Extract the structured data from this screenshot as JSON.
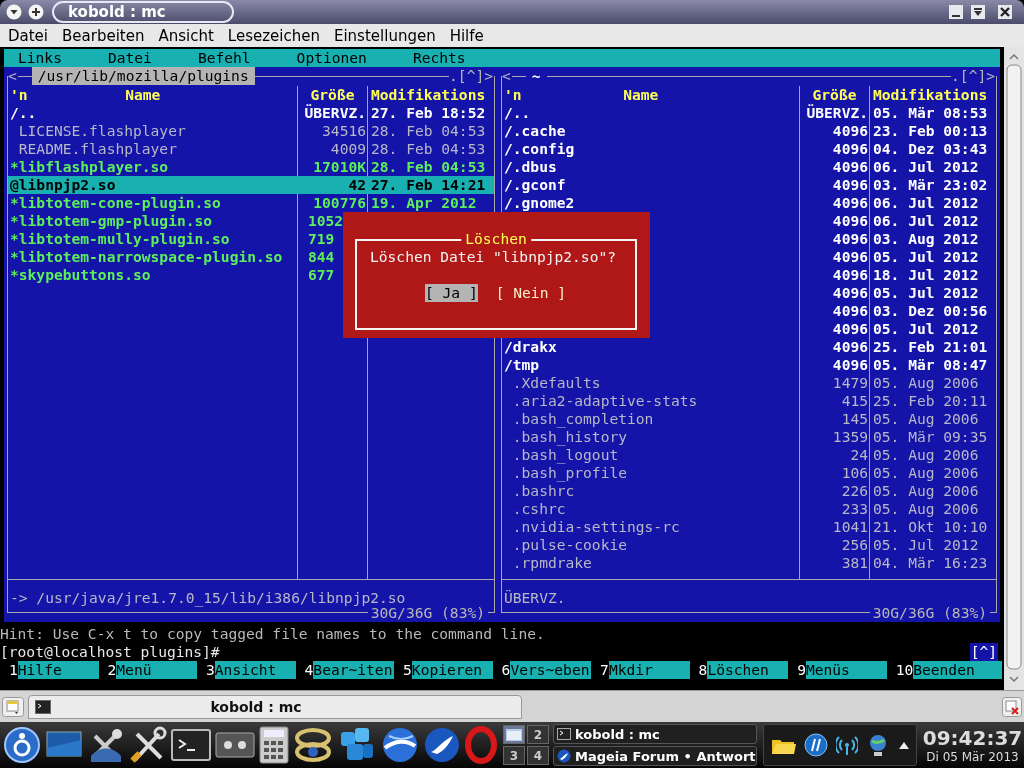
{
  "window": {
    "title": "kobold : mc"
  },
  "menu": [
    "Datei",
    "Bearbeiten",
    "Ansicht",
    "Lesezeichen",
    "Einstellungen",
    "Hilfe"
  ],
  "mc_menu": [
    "Links",
    "Datei",
    "Befehl",
    "Optionen",
    "Rechts"
  ],
  "panels": [
    {
      "active": true,
      "left_marker": "<",
      "path": "/usr/lib/mozilla/plugins",
      "right_marker": ".[^]>",
      "columns": [
        "'n",
        "Name",
        "Größe",
        "Modifikations"
      ],
      "rows": [
        {
          "kind": "dir",
          "name": "/..",
          "size": "ÜBERVZ.",
          "date": "27. Feb 18:52",
          "selected": false
        },
        {
          "kind": "file",
          "name": " LICENSE.flashplayer",
          "size": "34516",
          "date": "28. Feb 04:53",
          "selected": false
        },
        {
          "kind": "file",
          "name": " README.flashplayer",
          "size": "4009",
          "date": "28. Feb 04:53",
          "selected": false
        },
        {
          "kind": "exec",
          "name": "*libflashplayer.so",
          "size": "17010K",
          "date": "28. Feb 04:53",
          "selected": false
        },
        {
          "kind": "link",
          "name": "@libnpjp2.so",
          "size": "42",
          "date": "27. Feb 14:21",
          "selected": true
        },
        {
          "kind": "exec",
          "name": "*libtotem-cone-plugin.so",
          "size": "100776",
          "date": "19. Apr 2012",
          "selected": false
        },
        {
          "kind": "exec",
          "name": "*libtotem-gmp-plugin.so",
          "size": "1052",
          "clipped": true,
          "selected": false
        },
        {
          "kind": "exec",
          "name": "*libtotem-mully-plugin.so",
          "size": "719",
          "clipped": true,
          "selected": false
        },
        {
          "kind": "exec",
          "name": "*libtotem-narrowspace-plugin.so",
          "size": "844",
          "clipped": true,
          "selected": false
        },
        {
          "kind": "exec",
          "name": "*skypebuttons.so",
          "size": "677",
          "clipped": true,
          "selected": false
        }
      ],
      "status": "-> /usr/java/jre1.7.0_15/lib/i386/libnpjp2.so",
      "disk": "30G/36G (83%)"
    },
    {
      "active": false,
      "left_marker": "<",
      "path": "~",
      "right_marker": ".[^]>",
      "columns": [
        "'n",
        "Name",
        "Größe",
        "Modifikations"
      ],
      "rows": [
        {
          "kind": "dir",
          "name": "/..",
          "size": "ÜBERVZ.",
          "date": "05. Mär 08:53",
          "selected": false
        },
        {
          "kind": "dir",
          "name": "/.cache",
          "size": "4096",
          "date": "23. Feb 00:13",
          "selected": false
        },
        {
          "kind": "dir",
          "name": "/.config",
          "size": "4096",
          "date": "04. Dez 03:43",
          "selected": false
        },
        {
          "kind": "dir",
          "name": "/.dbus",
          "size": "4096",
          "date": "06. Jul 2012",
          "selected": false
        },
        {
          "kind": "dir",
          "name": "/.gconf",
          "size": "4096",
          "date": "03. Mär 23:02",
          "selected": false
        },
        {
          "kind": "dir",
          "name": "/.gnome2",
          "size": "4096",
          "date": "06. Jul 2012",
          "selected": false
        },
        {
          "kind": "dir",
          "size": "4096",
          "date": "06. Jul 2012",
          "selected": false
        },
        {
          "kind": "dir",
          "size": "4096",
          "date": "03. Aug 2012",
          "selected": false
        },
        {
          "kind": "dir",
          "size": "4096",
          "date": "05. Jul 2012",
          "selected": false
        },
        {
          "kind": "dir",
          "size": "4096",
          "date": "18. Jul 2012",
          "selected": false
        },
        {
          "kind": "dir",
          "size": "4096",
          "date": "05. Jul 2012",
          "selected": false
        },
        {
          "kind": "dir",
          "size": "4096",
          "date": "03. Dez 00:56",
          "selected": false
        },
        {
          "kind": "dir",
          "size": "4096",
          "date": "05. Jul 2012",
          "selected": false
        },
        {
          "kind": "dir",
          "name": "/drakx",
          "size": "4096",
          "date": "25. Feb 21:01",
          "selected": false
        },
        {
          "kind": "dir",
          "name": "/tmp",
          "size": "4096",
          "date": "05. Mär 08:47",
          "selected": false
        },
        {
          "kind": "file",
          "name": " .Xdefaults",
          "size": "1479",
          "date": "05. Aug 2006",
          "selected": false
        },
        {
          "kind": "file",
          "name": " .aria2-adaptive-stats",
          "size": "415",
          "date": "25. Feb 20:11",
          "selected": false
        },
        {
          "kind": "file",
          "name": " .bash_completion",
          "size": "145",
          "date": "05. Aug 2006",
          "selected": false
        },
        {
          "kind": "file",
          "name": " .bash_history",
          "size": "1359",
          "date": "05. Mär 09:35",
          "selected": false
        },
        {
          "kind": "file",
          "name": " .bash_logout",
          "size": "24",
          "date": "05. Aug 2006",
          "selected": false
        },
        {
          "kind": "file",
          "name": " .bash_profile",
          "size": "106",
          "date": "05. Aug 2006",
          "selected": false
        },
        {
          "kind": "file",
          "name": " .bashrc",
          "size": "226",
          "date": "05. Aug 2006",
          "selected": false
        },
        {
          "kind": "file",
          "name": " .cshrc",
          "size": "233",
          "date": "05. Aug 2006",
          "selected": false
        },
        {
          "kind": "file",
          "name": " .nvidia-settings-rc",
          "size": "1041",
          "date": "21. Okt 10:10",
          "selected": false
        },
        {
          "kind": "file",
          "name": " .pulse-cookie",
          "size": "256",
          "date": "05. Jul 2012",
          "selected": false
        },
        {
          "kind": "file",
          "name": " .rpmdrake",
          "size": "381",
          "date": "04. Mär 16:23",
          "selected": false
        }
      ],
      "status": "ÜBERVZ.",
      "disk": "30G/36G (83%)"
    }
  ],
  "dialog": {
    "title": "Löschen",
    "message": "Löschen Datei \"libnpjp2.so\"?",
    "buttons": [
      {
        "label": "[ Ja ]",
        "selected": true
      },
      {
        "label": "[ Nein ]",
        "selected": false
      }
    ]
  },
  "hint": "Hint: Use C-x t to copy tagged file names to the command line.",
  "prompt": "[root@localhost plugins]#",
  "scroll_marker": "[^]",
  "function_keys": [
    {
      "key": "1",
      "label": "Hilfe"
    },
    {
      "key": "2",
      "label": "Menü"
    },
    {
      "key": "3",
      "label": "Ansicht"
    },
    {
      "key": "4",
      "label": "Bear~iten"
    },
    {
      "key": "5",
      "label": "Kopieren"
    },
    {
      "key": "6",
      "label": "Vers~eben"
    },
    {
      "key": "7",
      "label": "Mkdir"
    },
    {
      "key": "8",
      "label": "Löschen"
    },
    {
      "key": "9",
      "label": "Menüs"
    },
    {
      "key": "10",
      "label": "Beenden"
    }
  ],
  "konsole_tabs": [
    {
      "label": "kobold : mc",
      "selected": true
    }
  ],
  "taskbar": {
    "pager": [
      {
        "selected": true
      },
      {
        "label": "2",
        "selected": false
      },
      {
        "label": "3",
        "selected": false
      },
      {
        "label": "4",
        "selected": false
      }
    ],
    "tasks": [
      {
        "label": "kobold : mc",
        "kind": "terminal"
      },
      {
        "label": "Mageia Forum • Antwort",
        "kind": "browser"
      }
    ],
    "clock": {
      "time": "09:42:37",
      "date": "Di 05 Mär 2013"
    }
  }
}
